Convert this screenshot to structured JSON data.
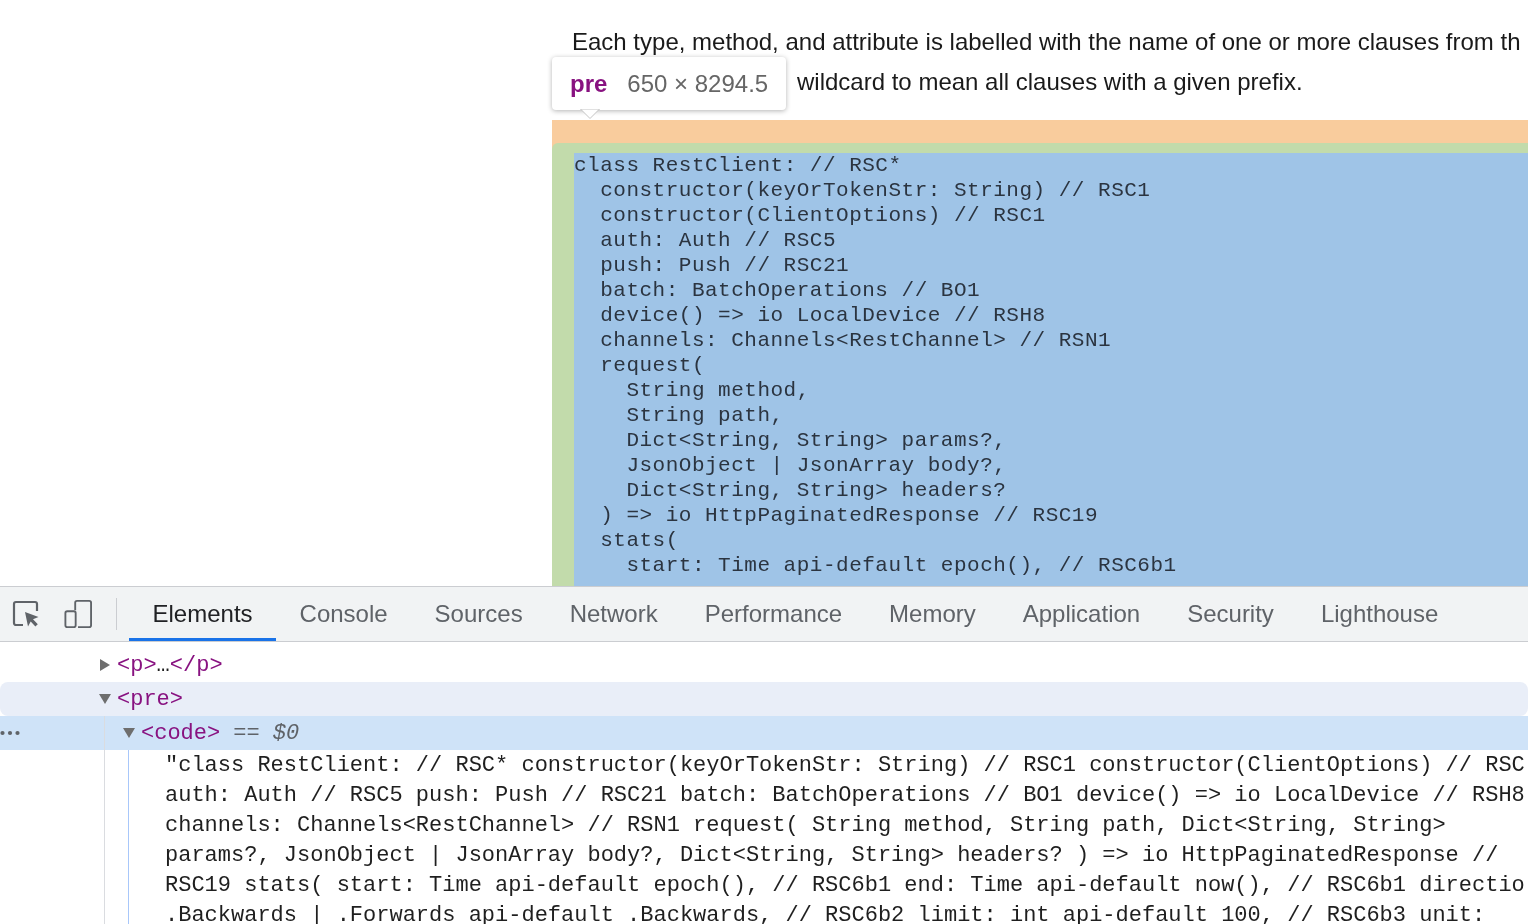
{
  "page": {
    "paragraph_lines": [
      "Each type, method, and attribute is labelled with the name of one or more clauses from th",
      "wildcard to mean all clauses with a given prefix."
    ],
    "code_block": {
      "lines": [
        {
          "text": "class RestClient: // RSC*",
          "children": [
            {
              "text": "constructor(keyOrTokenStr: String) // RSC1"
            },
            {
              "text": "constructor(ClientOptions) // RSC1"
            },
            {
              "text": "auth: Auth // RSC5"
            },
            {
              "text": "push: Push // RSC21"
            },
            {
              "text": "batch: BatchOperations // BO1"
            },
            {
              "text": "device() => io LocalDevice // RSH8"
            },
            {
              "text": "channels: Channels<RestChannel> // RSN1"
            },
            {
              "text": "request(",
              "children": [
                {
                  "text": "String method,"
                },
                {
                  "text": "String path,"
                },
                {
                  "text": "Dict<String, String> params?,"
                },
                {
                  "text": "JsonObject | JsonArray body?,"
                },
                {
                  "text": "Dict<String, String> headers?"
                }
              ]
            },
            {
              "text": ") => io HttpPaginatedResponse // RSC19"
            },
            {
              "text": "stats(",
              "children": [
                {
                  "text": "start: Time api-default epoch(), // RSC6b1"
                }
              ]
            }
          ]
        }
      ]
    }
  },
  "inspect_tooltip": {
    "tag": "pre",
    "size": "650 × 8294.5"
  },
  "devtools": {
    "tabs": [
      {
        "label": "Elements",
        "selected": true
      },
      {
        "label": "Console",
        "selected": false
      },
      {
        "label": "Sources",
        "selected": false
      },
      {
        "label": "Network",
        "selected": false
      },
      {
        "label": "Performance",
        "selected": false
      },
      {
        "label": "Memory",
        "selected": false
      },
      {
        "label": "Application",
        "selected": false
      },
      {
        "label": "Security",
        "selected": false
      },
      {
        "label": "Lighthouse",
        "selected": false
      }
    ],
    "tree": {
      "nodes": [
        {
          "kind": "element",
          "open_tag": "<p>",
          "content": "…",
          "close_tag": "</p>",
          "expanded": false,
          "selected": false,
          "hovered": false
        },
        {
          "kind": "element",
          "open_tag": "<pre>",
          "expanded": true,
          "selected": false,
          "hovered": true,
          "children": [
            {
              "kind": "element",
              "open_tag": "<code>",
              "marker": "== *$0*",
              "expanded": true,
              "selected": true,
              "hovered": false,
              "children": [
                {
                  "kind": "text",
                  "lines": [
                    "\"class RestClient: // RSC* constructor(keyOrTokenStr: String) // RSC1 constructor(ClientOptions) // RSC",
                    "auth: Auth // RSC5 push: Push // RSC21 batch: BatchOperations // BO1 device() => io LocalDevice // RSH8",
                    "channels: Channels<RestChannel> // RSN1 request( String method, String path, Dict<String, String>",
                    "params?, JsonObject | JsonArray body?, Dict<String, String> headers? ) => io HttpPaginatedResponse //",
                    "RSC19 stats( start: Time api-default epoch(), // RSC6b1 end: Time api-default now(), // RSC6b1 directio",
                    ".Backwards | .Forwards api-default .Backwards, // RSC6b2 limit: int api-default 100, // RSC6b3 unit:"
                  ]
                }
              ]
            }
          ]
        }
      ]
    }
  }
}
